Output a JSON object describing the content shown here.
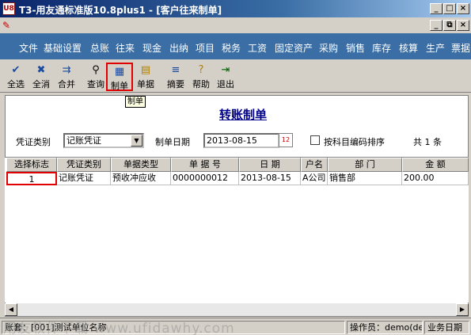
{
  "window": {
    "title": "T3-用友通标准版10.8plus1 - [客户往来制单]",
    "app_icon": "U8",
    "controls": [
      "_",
      "□",
      "×"
    ],
    "child_controls": [
      "_",
      "⧉",
      "×"
    ]
  },
  "menu": [
    "文件",
    "基础设置",
    "总账",
    "往来",
    "现金",
    "出纳",
    "项目",
    "税务",
    "工资",
    "固定资产",
    "采购",
    "销售",
    "库存",
    "核算",
    "生产",
    "票据"
  ],
  "toolbar": {
    "items": [
      {
        "label": "全选",
        "icon": "select-all-icon"
      },
      {
        "label": "全消",
        "icon": "deselect-all-icon"
      },
      {
        "label": "合并",
        "icon": "merge-icon"
      },
      {
        "label": "查询",
        "icon": "binoculars-icon"
      },
      {
        "label": "制单",
        "icon": "voucher-make-icon"
      },
      {
        "label": "单据",
        "icon": "document-icon"
      },
      {
        "label": "摘要",
        "icon": "summary-icon"
      },
      {
        "label": "帮助",
        "icon": "help-icon"
      },
      {
        "label": "退出",
        "icon": "exit-icon"
      }
    ],
    "tooltip": "制单"
  },
  "form": {
    "title": "转账制单",
    "voucher_type_label": "凭证类别",
    "voucher_type_value": "记账凭证",
    "date_label": "制单日期",
    "date_value": "2013-08-15",
    "sort_checkbox_label": "按科目编码排序",
    "count_text": "共 1 条"
  },
  "grid": {
    "headers": [
      "选择标志",
      "凭证类别",
      "单据类型",
      "单 据 号",
      "日 期",
      "户名",
      "部 门",
      "金 额"
    ],
    "rows": [
      [
        "1",
        "记账凭证",
        "预收冲应收",
        "0000000012",
        "2013-08-15",
        "A公司",
        "销售部",
        "200.00"
      ]
    ]
  },
  "statusbar": {
    "left": "账套：[001]测试单位名称",
    "operator": "操作员：demo(de",
    "business": "业务日期"
  },
  "watermark": "用友软件下载 www.ufidawhy.com",
  "colors": {
    "menubar": "#3a6ea5",
    "title": "#0a246a",
    "highlight": "#e00000",
    "form_title": "#00008b"
  }
}
